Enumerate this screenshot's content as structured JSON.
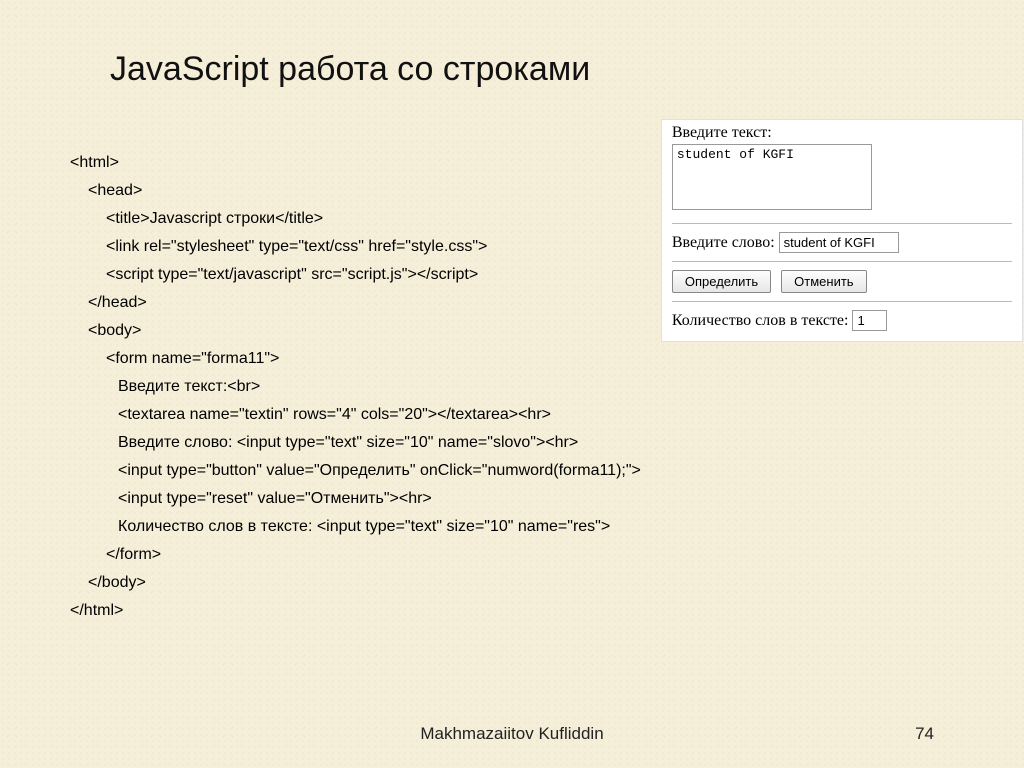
{
  "title": "JavaScript работа со строками",
  "code": {
    "l0": "<html>",
    "l1": "<head>",
    "l2": "<title>Javascript строки</title>",
    "l3": "<link rel=\"stylesheet\" type=\"text/css\" href=\"style.css\">",
    "l4": "<script type=\"text/javascript\" src=\"script.js\"></script>",
    "l5": "</head>",
    "l6": "<body>",
    "l7": "<form name=\"forma11\">",
    "l8": "Введите текст:<br>",
    "l9": "<textarea name=\"textin\" rows=\"4\" cols=\"20\"></textarea><hr>",
    "l10": "Введите слово: <input type=\"text\" size=\"10\" name=\"slovo\"><hr>",
    "l11": "<input type=\"button\" value=\"Определить\" onClick=\"numword(forma11);\">",
    "l12": "<input type=\"reset\" value=\"Отменить\"><hr>",
    "l13": "Количество слов в тексте: <input type=\"text\" size=\"10\" name=\"res\">",
    "l14": "</form>",
    "l15": "</body>",
    "l16": "</html>"
  },
  "demo": {
    "label_text": "Введите текст:",
    "textarea_value": "student of KGFI",
    "label_word": "Введите слово:",
    "slovo_value": "student of KGFI",
    "btn_define": "Определить",
    "btn_cancel": "Отменить",
    "label_count": "Количество слов в тексте:",
    "res_value": "1"
  },
  "footer": "Makhmazaiitov Kufliddin",
  "page": "74"
}
